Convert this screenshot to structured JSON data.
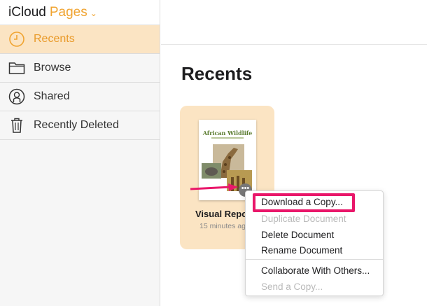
{
  "brand": {
    "icloud": "iCloud",
    "app": "Pages",
    "chevron": "⌄"
  },
  "sidebar": {
    "items": [
      {
        "label": "Recents",
        "icon": "clock-icon",
        "active": true
      },
      {
        "label": "Browse",
        "icon": "folder-icon",
        "active": false
      },
      {
        "label": "Shared",
        "icon": "shared-person-icon",
        "active": false
      },
      {
        "label": "Recently Deleted",
        "icon": "trash-icon",
        "active": false
      }
    ]
  },
  "main": {
    "title": "Recents",
    "document": {
      "thumb_title": "African Wildlife",
      "name": "Visual Repo",
      "time": "15 minutes ag"
    },
    "more_button": "•••",
    "context_menu": {
      "items": [
        {
          "label": "Download a Copy...",
          "disabled": false
        },
        {
          "label": "Duplicate Document",
          "disabled": true
        },
        {
          "label": "Delete Document",
          "disabled": false
        },
        {
          "label": "Rename Document",
          "disabled": false
        },
        {
          "label": "Collaborate With Others...",
          "disabled": false
        },
        {
          "label": "Send a Copy...",
          "disabled": true
        }
      ]
    }
  },
  "colors": {
    "accent": "#f0a431",
    "active_bg": "#fbe4c3",
    "highlight": "#e9176a"
  }
}
